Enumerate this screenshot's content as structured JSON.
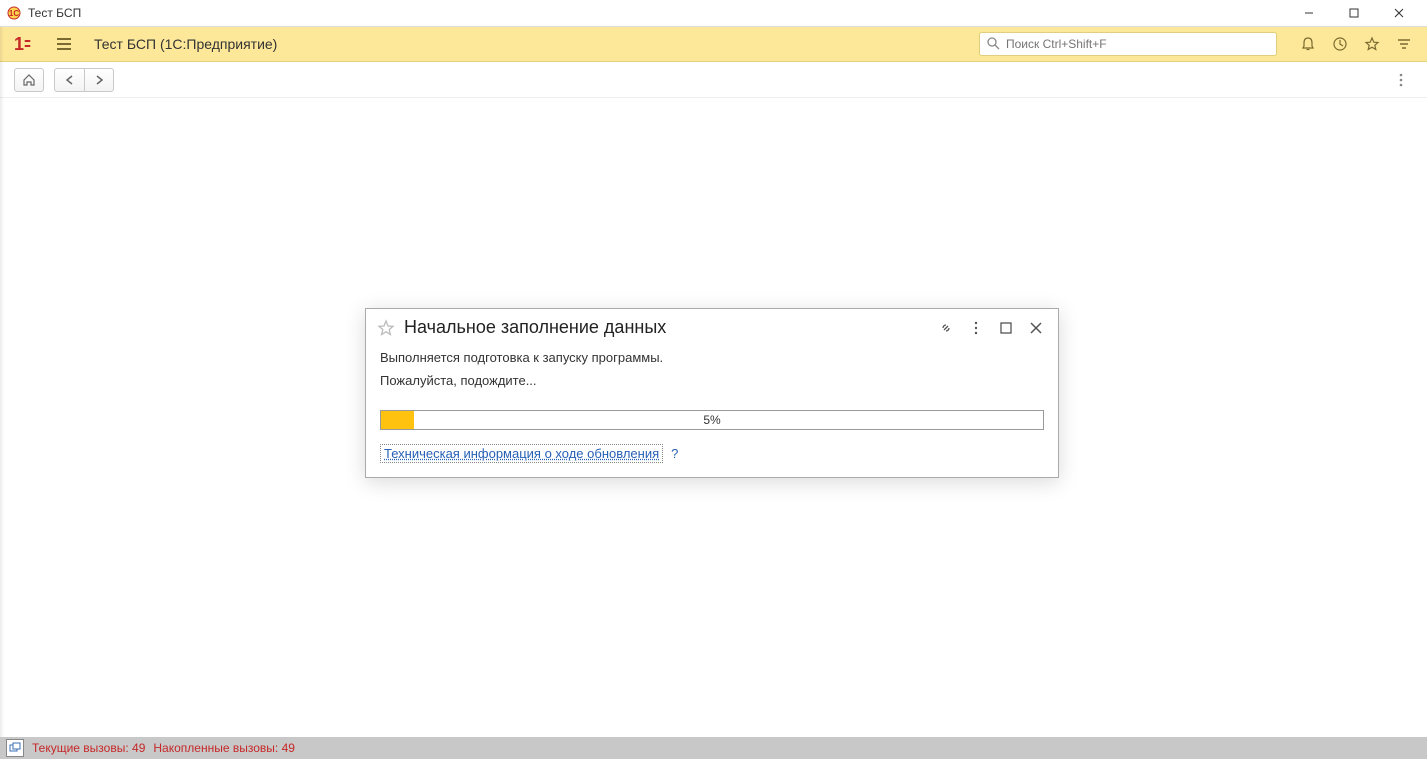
{
  "window": {
    "title": "Тест БСП"
  },
  "header": {
    "app_title": "Тест БСП  (1С:Предприятие)",
    "search_placeholder": "Поиск Ctrl+Shift+F"
  },
  "dialog": {
    "title": "Начальное заполнение данных",
    "line1": "Выполняется подготовка к запуску программы.",
    "line2": "Пожалуйста, подождите...",
    "progress_percent": 5,
    "progress_label": "5%",
    "tech_link": "Техническая информация о ходе обновления",
    "help": "?"
  },
  "statusbar": {
    "current_calls_label": "Текущие вызовы:",
    "current_calls_value": "49",
    "accumulated_calls_label": "Накопленные вызовы:",
    "accumulated_calls_value": "49"
  }
}
